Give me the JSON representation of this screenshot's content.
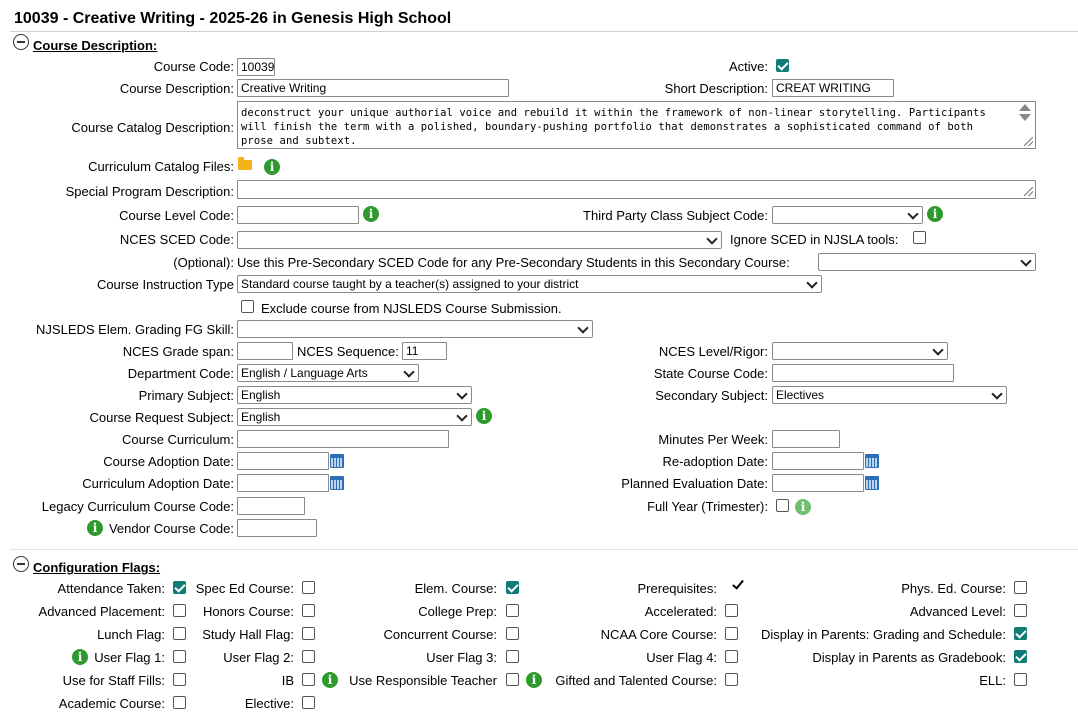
{
  "page_title": "10039 - Creative Writing - 2025-26 in Genesis High School",
  "course_description_section": {
    "heading": "Course Description:",
    "course_code_label": "Course Code:",
    "course_code_value": "10039",
    "active_label": "Active:",
    "active_checked": true,
    "course_description_label": "Course Description:",
    "course_description_value": "Creative Writing",
    "short_description_label": "Short Description:",
    "short_description_value": "CREAT WRITING",
    "catalog_description_label": "Course Catalog Description:",
    "catalog_description_value": "deconstruct your unique authorial voice and rebuild it within the framework of non-linear storytelling. Participants will finish the term with a polished, boundary-pushing portfolio that demonstrates a sophisticated command of both prose and subtext.",
    "curriculum_catalog_files_label": "Curriculum Catalog Files:",
    "special_program_label": "Special Program Description:",
    "course_level_code_label": "Course Level Code:",
    "third_party_label": "Third Party Class Subject Code:",
    "nces_sced_label": "NCES SCED Code:",
    "ignore_sced_label": "Ignore SCED in NJSLA tools:",
    "optional_label": "(Optional):",
    "optional_text": "Use this Pre-Secondary SCED Code for any Pre-Secondary Students in this Secondary Course:",
    "instruction_type_label": "Course Instruction Type",
    "instruction_type_value": "Standard course taught by a teacher(s) assigned to your district",
    "exclude_label": "Exclude course from NJSLEDS Course Submission.",
    "njsleds_label": "NJSLEDS Elem. Grading FG Skill:",
    "nces_grade_span_label": "NCES Grade span:",
    "nces_sequence_label": "NCES Sequence:",
    "nces_sequence_value": "11",
    "nces_level_label": "NCES Level/Rigor:",
    "department_label": "Department Code:",
    "department_value": "English / Language Arts",
    "state_course_label": "State Course Code:",
    "primary_subject_label": "Primary Subject:",
    "primary_subject_value": "English",
    "secondary_subject_label": "Secondary Subject:",
    "secondary_subject_value": "Electives",
    "request_subject_label": "Course Request Subject:",
    "request_subject_value": "English",
    "course_curriculum_label": "Course Curriculum:",
    "minutes_label": "Minutes Per Week:",
    "adoption_date_label": "Course Adoption Date:",
    "readoption_label": "Re-adoption Date:",
    "curriculum_adoption_label": "Curriculum Adoption Date:",
    "planned_eval_label": "Planned Evaluation Date:",
    "legacy_label": "Legacy Curriculum Course Code:",
    "full_year_label": "Full Year (Trimester):",
    "vendor_label": "Vendor Course Code:"
  },
  "configuration_flags": {
    "heading": "Configuration Flags:",
    "flags": [
      {
        "label": "Attendance Taken:",
        "checked": true
      },
      {
        "label": "Spec Ed Course:",
        "checked": false
      },
      {
        "label": "Elem. Course:",
        "checked": true
      },
      {
        "label": "Prerequisites:",
        "checked": true
      },
      {
        "label": "Phys. Ed. Course:",
        "checked": false
      },
      {
        "label": "Advanced Placement:",
        "checked": false
      },
      {
        "label": "Honors Course:",
        "checked": false
      },
      {
        "label": "College Prep:",
        "checked": false
      },
      {
        "label": "Accelerated:",
        "checked": false
      },
      {
        "label": "Advanced Level:",
        "checked": false
      },
      {
        "label": "Lunch Flag:",
        "checked": false
      },
      {
        "label": "Study Hall Flag:",
        "checked": false
      },
      {
        "label": "Concurrent Course:",
        "checked": false
      },
      {
        "label": "NCAA Core Course:",
        "checked": false
      },
      {
        "label": "Display in Parents: Grading and Schedule:",
        "checked": true
      },
      {
        "label": "User Flag 1:",
        "checked": false
      },
      {
        "label": "User Flag 2:",
        "checked": false
      },
      {
        "label": "User Flag 3:",
        "checked": false
      },
      {
        "label": "User Flag 4:",
        "checked": false
      },
      {
        "label": "Display in Parents as Gradebook:",
        "checked": true
      },
      {
        "label": "Use for Staff Fills:",
        "checked": false
      },
      {
        "label": "IB",
        "checked": false
      },
      {
        "label": "Use Responsible Teacher",
        "checked": false
      },
      {
        "label": "Gifted and Talented Course:",
        "checked": false
      },
      {
        "label": "ELL:",
        "checked": false
      },
      {
        "label": "Academic Course:",
        "checked": false
      },
      {
        "label": "Elective:",
        "checked": false
      }
    ]
  },
  "icons": {
    "collapse": "collapse-minus-icon",
    "info": "info-icon",
    "folder": "folder-icon",
    "calendar": "calendar-icon",
    "checkmark": "checkmark-icon"
  },
  "colors": {
    "checkbox_checked": "#0f7d75",
    "info_green": "#2e9a2e",
    "folder_yellow": "#f2b21a",
    "calendar_blue": "#2d6fb5"
  }
}
